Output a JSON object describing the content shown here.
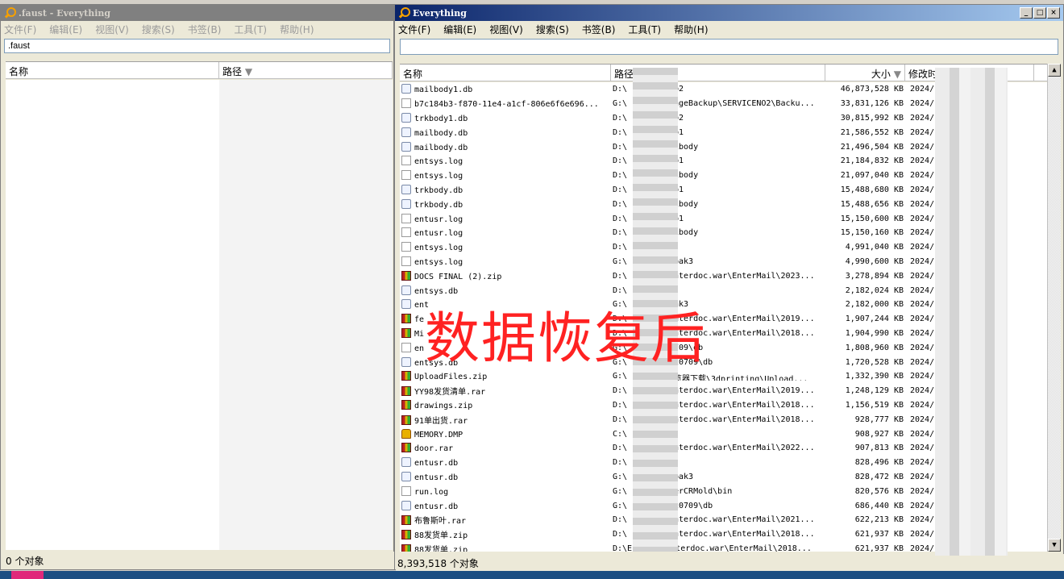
{
  "left": {
    "title": ".faust - Everything",
    "menu": [
      "文件(F)",
      "编辑(E)",
      "视图(V)",
      "搜索(S)",
      "书签(B)",
      "工具(T)",
      "帮助(H)"
    ],
    "search_value": ".faust",
    "columns": [
      "名称",
      "路径"
    ],
    "status": "0 个对象"
  },
  "right": {
    "title": "Everything",
    "menu": [
      "文件(F)",
      "编辑(E)",
      "视图(V)",
      "搜索(S)",
      "书签(B)",
      "工具(T)",
      "帮助(H)"
    ],
    "search_value": "",
    "columns": [
      "名称",
      "路径",
      "大小",
      "修改时间"
    ],
    "status": "8,393,518 个对象",
    "rows": [
      {
        "icon": "db",
        "name": "mailbody1.db",
        "path": "D:\\",
        "path2": "b2",
        "size": "46,873,528 KB",
        "date": "2024/"
      },
      {
        "icon": "file",
        "name": "b7c184b3-f870-11e4-a1cf-806e6f6e696...",
        "path": "G:\\",
        "path2": "ageBackup\\SERVICENO2\\Backu...",
        "size": "33,831,126 KB",
        "date": "2024/"
      },
      {
        "icon": "db",
        "name": "trkbody1.db",
        "path": "D:\\",
        "path2": "b2",
        "size": "30,815,992 KB",
        "date": "2024/"
      },
      {
        "icon": "db",
        "name": "mailbody.db",
        "path": "D:\\",
        "path2": "b1",
        "size": "21,586,552 KB",
        "date": "2024/"
      },
      {
        "icon": "db",
        "name": "mailbody.db",
        "path": "D:\\",
        "path2": "ibody",
        "size": "21,496,504 KB",
        "date": "2024/"
      },
      {
        "icon": "file",
        "name": "entsys.log",
        "path": "D:\\",
        "path2": "b1",
        "size": "21,184,832 KB",
        "date": "2024/"
      },
      {
        "icon": "file",
        "name": "entsys.log",
        "path": "D:\\",
        "path2": "ibody",
        "size": "21,097,040 KB",
        "date": "2024/"
      },
      {
        "icon": "db",
        "name": "trkbody.db",
        "path": "D:\\",
        "path2": "b1",
        "size": "15,488,680 KB",
        "date": "2024/"
      },
      {
        "icon": "db",
        "name": "trkbody.db",
        "path": "D:\\",
        "path2": "ibody",
        "size": "15,488,656 KB",
        "date": "2024/"
      },
      {
        "icon": "file",
        "name": "entusr.log",
        "path": "D:\\",
        "path2": "b1",
        "size": "15,150,600 KB",
        "date": "2024/"
      },
      {
        "icon": "file",
        "name": "entusr.log",
        "path": "D:\\",
        "path2": "ibody",
        "size": "15,150,160 KB",
        "date": "2024/"
      },
      {
        "icon": "file",
        "name": "entsys.log",
        "path": "D:\\",
        "path2": "",
        "size": "4,991,040 KB",
        "date": "2024/"
      },
      {
        "icon": "file",
        "name": "entsys.log",
        "path": "G:\\",
        "path2": "bak3",
        "size": "4,990,600 KB",
        "date": "2024/"
      },
      {
        "icon": "arc",
        "name": "DOCS FINAL (2).zip",
        "path": "D:\\",
        "path2": "nterdoc.war\\EnterMail\\2023...",
        "size": "3,278,894 KB",
        "date": "2024/"
      },
      {
        "icon": "db",
        "name": "entsys.db",
        "path": "D:\\",
        "path2": "",
        "size": "2,182,024 KB",
        "date": "2024/"
      },
      {
        "icon": "db",
        "name": "ent",
        "path": "G:\\",
        "path2": "ak3",
        "size": "2,182,000 KB",
        "date": "2024/"
      },
      {
        "icon": "arc",
        "name": "fe",
        "path": "D:\\",
        "path2": "nterdoc.war\\EnterMail\\2019...",
        "size": "1,907,244 KB",
        "date": "2024/"
      },
      {
        "icon": "arc",
        "name": "Mi",
        "path": "D:\\",
        "path2": "nterdoc.war\\EnterMail\\2018...",
        "size": "1,904,990 KB",
        "date": "2024/"
      },
      {
        "icon": "file",
        "name": "en",
        "path": "G:\\",
        "path2": "709\\db",
        "size": "1,808,960 KB",
        "date": "2024/"
      },
      {
        "icon": "db",
        "name": "entsys.db",
        "path": "G:\\",
        "path2": "20709\\db",
        "size": "1,720,528 KB",
        "date": "2024/"
      },
      {
        "icon": "arc",
        "name": "UploadFiles.zip",
        "path": "G:\\",
        "path2": "览器下载\\3dprinting\\Upload...",
        "size": "1,332,390 KB",
        "date": "2024/"
      },
      {
        "icon": "arc",
        "name": "YY98发货清单.rar",
        "path": "D:\\",
        "path2": "nterdoc.war\\EnterMail\\2019...",
        "size": "1,248,129 KB",
        "date": "2024/"
      },
      {
        "icon": "arc",
        "name": "drawings.zip",
        "path": "D:\\",
        "path2": "nterdoc.war\\EnterMail\\2018...",
        "size": "1,156,519 KB",
        "date": "2024/"
      },
      {
        "icon": "arc",
        "name": "91单出货.rar",
        "path": "D:\\",
        "path2": "nterdoc.war\\EnterMail\\2018...",
        "size": "928,777 KB",
        "date": "2024/"
      },
      {
        "icon": "dmp",
        "name": "MEMORY.DMP",
        "path": "C:\\",
        "path2": "",
        "size": "908,927 KB",
        "date": "2024/"
      },
      {
        "icon": "arc",
        "name": "door.rar",
        "path": "D:\\",
        "path2": "nterdoc.war\\EnterMail\\2022...",
        "size": "907,813 KB",
        "date": "2024/"
      },
      {
        "icon": "db",
        "name": "entusr.db",
        "path": "D:\\",
        "path2": "",
        "size": "828,496 KB",
        "date": "2024/"
      },
      {
        "icon": "db",
        "name": "entusr.db",
        "path": "G:\\",
        "path2": "bak3",
        "size": "828,472 KB",
        "date": "2024/"
      },
      {
        "icon": "file",
        "name": "run.log",
        "path": "G:\\",
        "path2": "erCRMold\\bin",
        "size": "820,576 KB",
        "date": "2024/"
      },
      {
        "icon": "db",
        "name": "entusr.db",
        "path": "G:\\",
        "path2": "20709\\db",
        "size": "686,440 KB",
        "date": "2024/"
      },
      {
        "icon": "arc",
        "name": "布鲁斯叶.rar",
        "path": "D:\\",
        "path2": "nterdoc.war\\EnterMail\\2021...",
        "size": "622,213 KB",
        "date": "2024/"
      },
      {
        "icon": "arc",
        "name": "88发货单.zip",
        "path": "D:\\",
        "path2": "nterdoc.war\\EnterMail\\2018...",
        "size": "621,937 KB",
        "date": "2024/"
      },
      {
        "icon": "arc",
        "name": "88发货单.zip",
        "path": "D:\\Entsoft\\enterdoc.war\\EnterMail\\2018...",
        "path2": "",
        "size": "621,937 KB",
        "date": "2024/"
      }
    ]
  },
  "overlay_text": "数据恢复后"
}
